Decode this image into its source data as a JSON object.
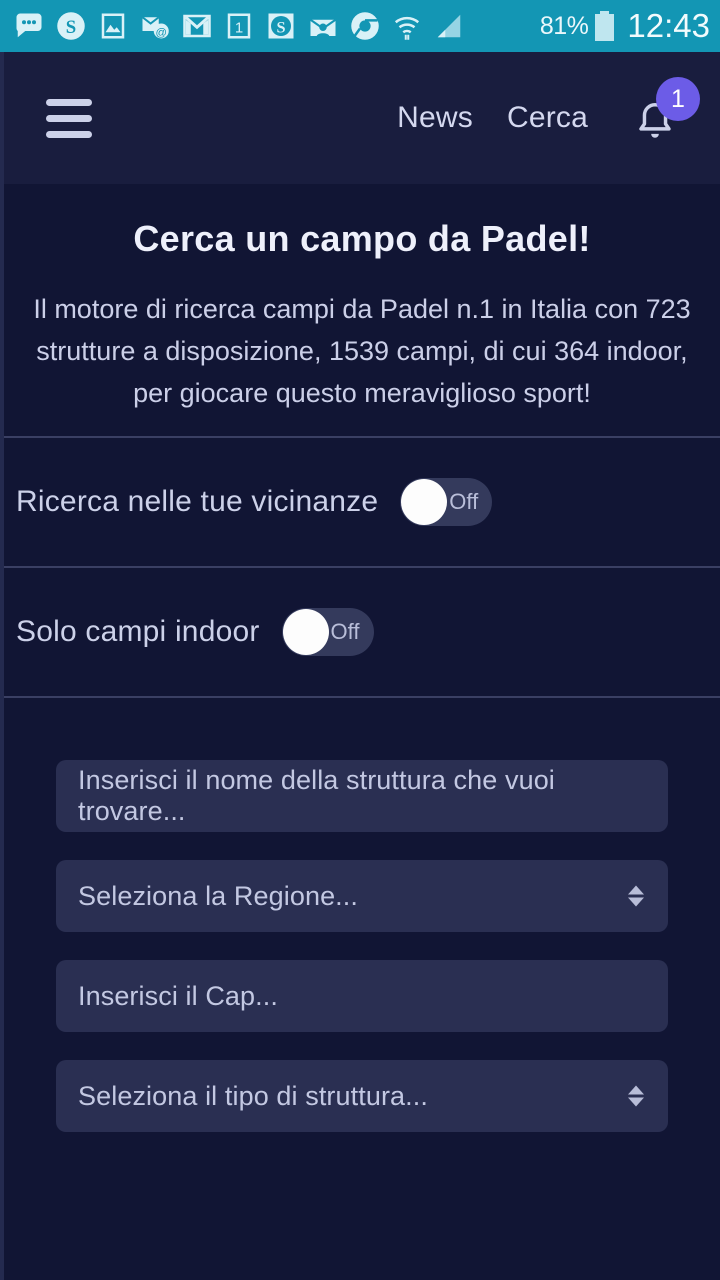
{
  "status_bar": {
    "icons": [
      "messages-icon",
      "skype-icon",
      "photos-icon",
      "mail-at-icon",
      "gmail-icon",
      "calendar-one-icon",
      "skype-business-icon",
      "envelope-contact-icon",
      "chrome-icon",
      "wifi-icon",
      "signal-icon"
    ],
    "battery_percent": "81%",
    "battery_icon": "battery-icon",
    "clock": "12:43"
  },
  "navbar": {
    "menu_icon": "hamburger-menu-icon",
    "links": [
      {
        "label": "News"
      },
      {
        "label": "Cerca"
      }
    ],
    "bell_icon": "notification-bell-icon",
    "badge_count": "1",
    "badge_color": "#6c5ce7"
  },
  "hero": {
    "title": "Cerca un campo da Padel!",
    "description": "Il motore di ricerca campi da Padel n.1 in Italia con 723 strutture a disposizione, 1539 campi, di cui 364 indoor, per giocare questo meraviglioso sport!"
  },
  "toggles": [
    {
      "label": "Ricerca nelle tue vicinanze",
      "state": "Off"
    },
    {
      "label": "Solo campi indoor",
      "state": "Off"
    }
  ],
  "form": {
    "fields": [
      {
        "type": "text",
        "placeholder": "Inserisci il nome della struttura che vuoi trovare...",
        "name": "structure-name-input"
      },
      {
        "type": "select",
        "placeholder": "Seleziona la Regione...",
        "name": "region-select"
      },
      {
        "type": "text",
        "placeholder": "Inserisci il Cap...",
        "name": "cap-input"
      },
      {
        "type": "select",
        "placeholder": "Seleziona il tipo di struttura...",
        "name": "structure-type-select"
      }
    ]
  }
}
